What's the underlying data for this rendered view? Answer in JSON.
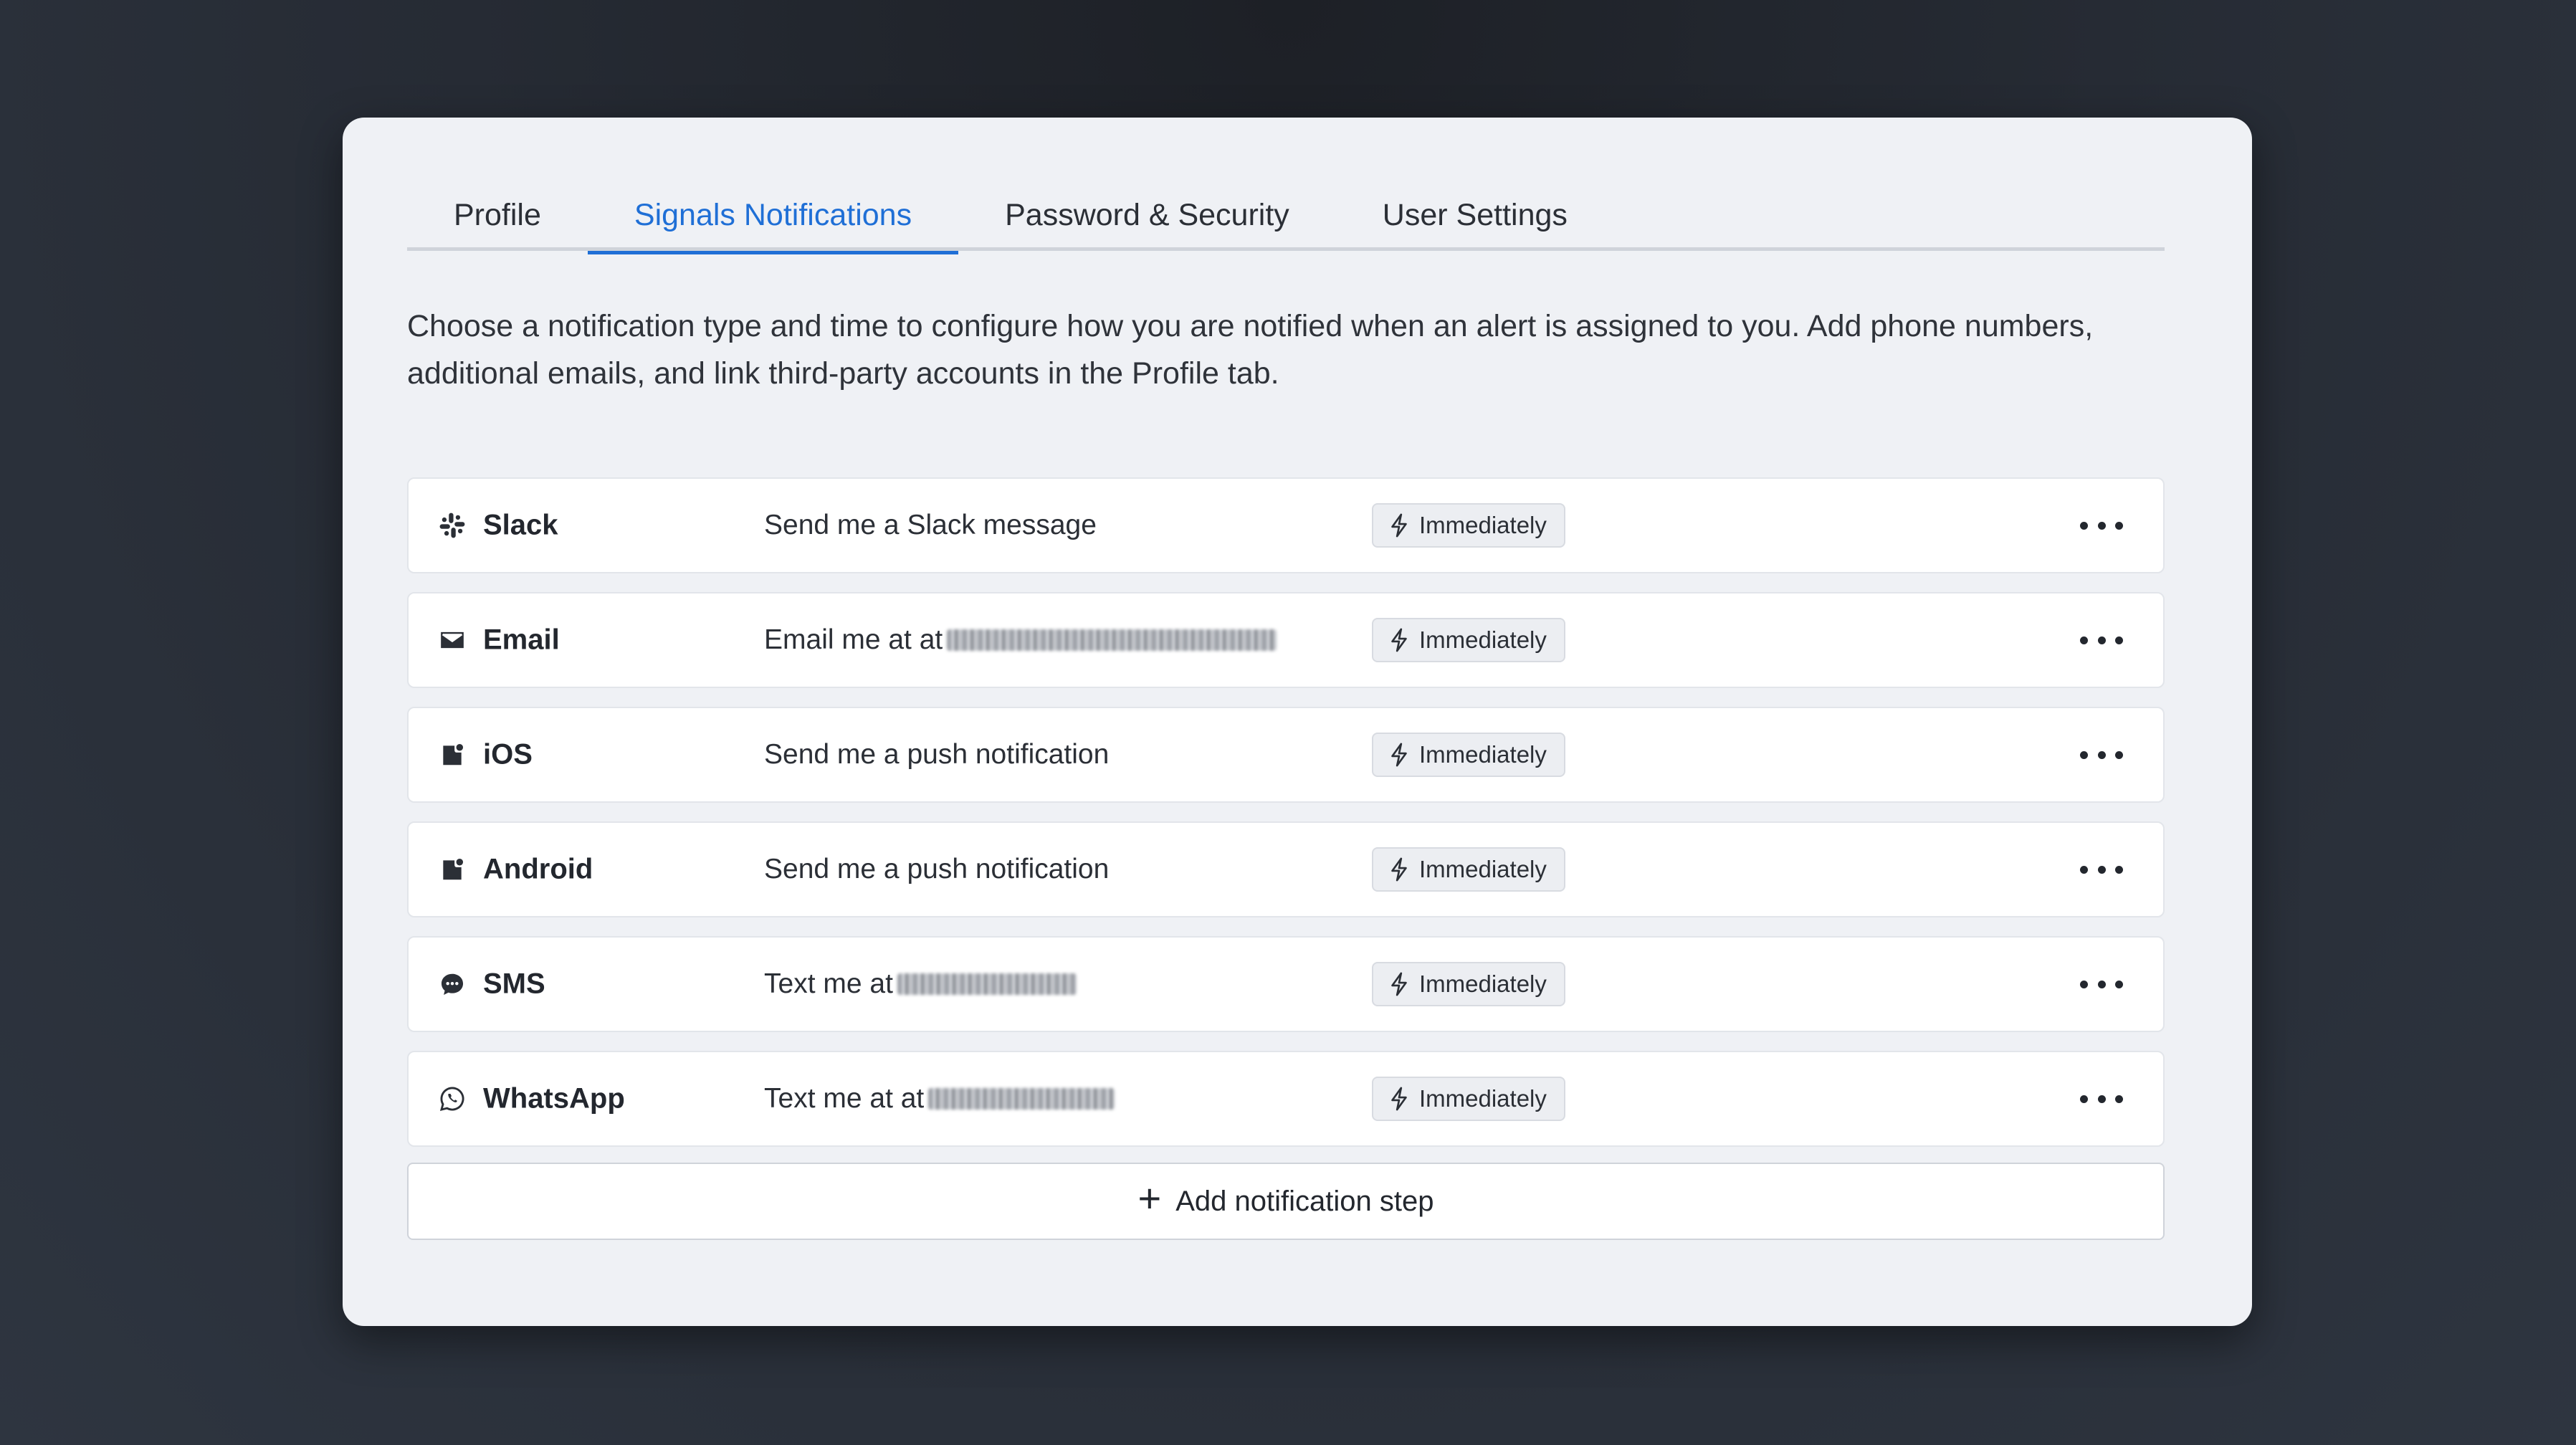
{
  "tabs": [
    {
      "label": "Profile",
      "active": false
    },
    {
      "label": "Signals Notifications",
      "active": true
    },
    {
      "label": "Password & Security",
      "active": false
    },
    {
      "label": "User Settings",
      "active": false
    }
  ],
  "description": "Choose a notification type and time to configure how you are notified when an alert is assigned to you. Add phone numbers, additional emails, and link third-party accounts in the Profile tab.",
  "colors": {
    "accent": "#1f6fd6",
    "card_bg": "#eff1f5"
  },
  "notifications": [
    {
      "name": "Slack",
      "icon": "slack-icon",
      "text": "Send me a Slack message",
      "redacted": false,
      "timing": "Immediately"
    },
    {
      "name": "Email",
      "icon": "mail-icon",
      "text": "Email me at at",
      "redacted": true,
      "timing": "Immediately"
    },
    {
      "name": "iOS",
      "icon": "mobile-notification-icon",
      "text": "Send me a push notification",
      "redacted": false,
      "timing": "Immediately"
    },
    {
      "name": "Android",
      "icon": "mobile-notification-icon",
      "text": "Send me a push notification",
      "redacted": false,
      "timing": "Immediately"
    },
    {
      "name": "SMS",
      "icon": "chat-bubble-icon",
      "text": "Text me at",
      "redacted": true,
      "timing": "Immediately"
    },
    {
      "name": "WhatsApp",
      "icon": "whatsapp-icon",
      "text": "Text me at at",
      "redacted": true,
      "timing": "Immediately"
    }
  ],
  "add_button_label": "Add notification step"
}
